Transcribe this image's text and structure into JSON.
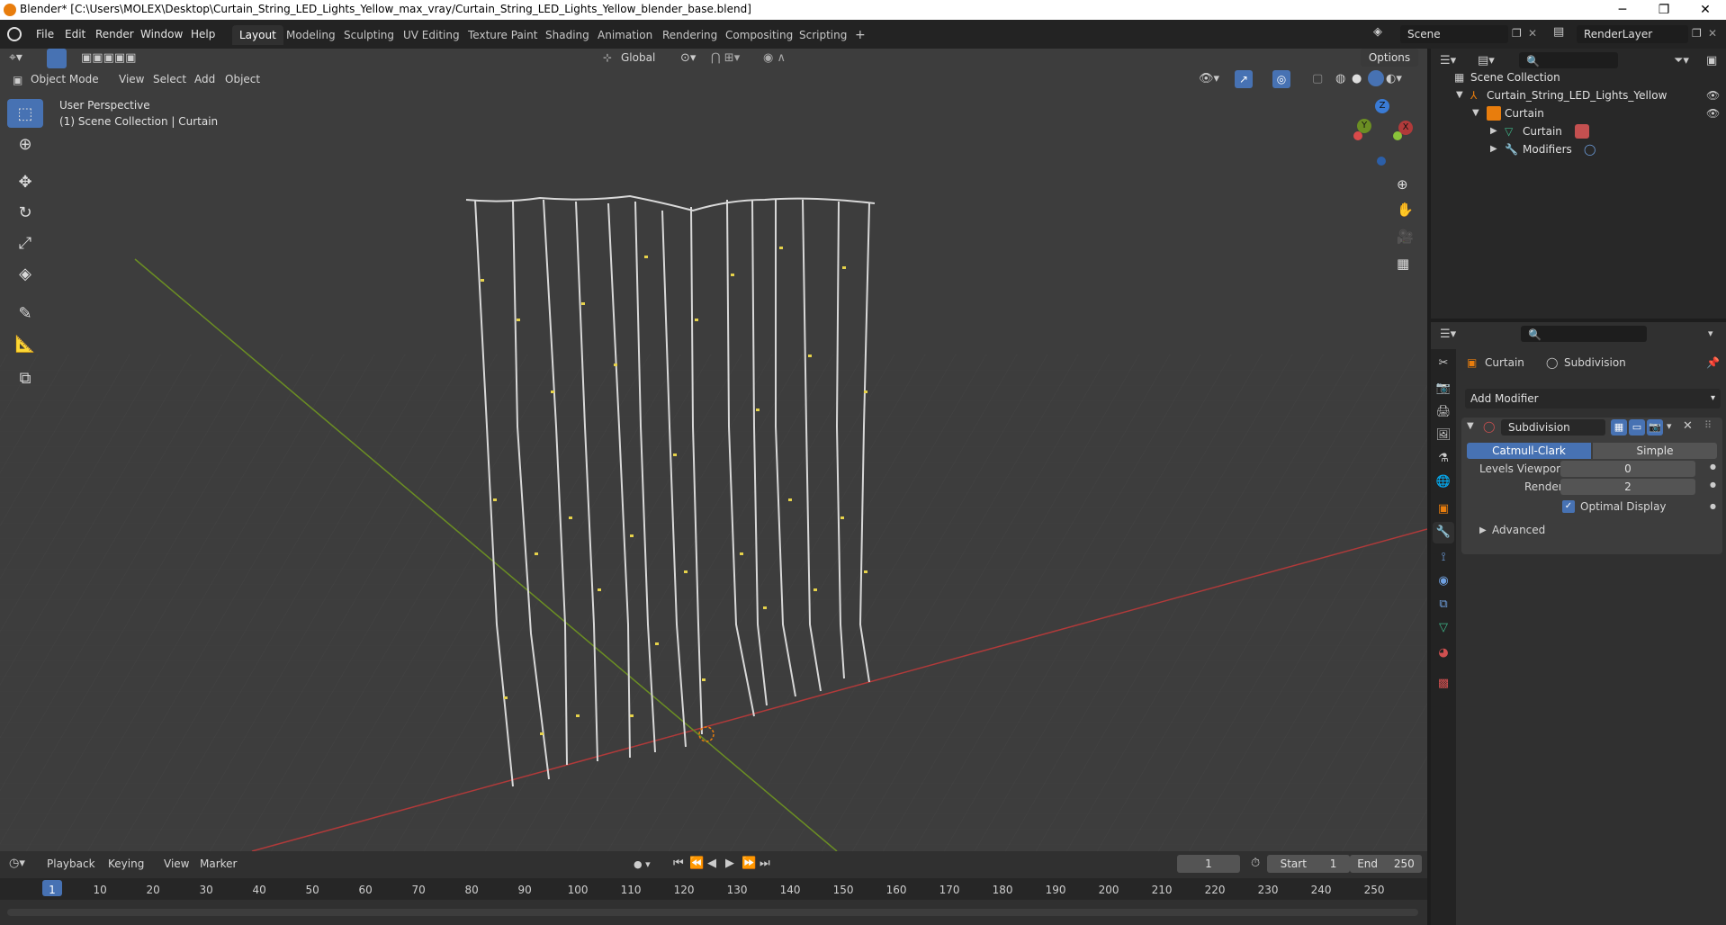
{
  "window": {
    "title": "Blender* [C:\\Users\\MOLEX\\Desktop\\Curtain_String_LED_Lights_Yellow_max_vray/Curtain_String_LED_Lights_Yellow_blender_base.blend]",
    "minimize": "─",
    "maximize": "❐",
    "close": "✕"
  },
  "menu": [
    "File",
    "Edit",
    "Render",
    "Window",
    "Help"
  ],
  "workspaces": [
    "Layout",
    "Modeling",
    "Sculpting",
    "UV Editing",
    "Texture Paint",
    "Shading",
    "Animation",
    "Rendering",
    "Compositing",
    "Scripting"
  ],
  "workspace_active": "Layout",
  "add_tab": "+",
  "scene": {
    "label": "Scene",
    "render_layer": "RenderLayer"
  },
  "viewport_header": {
    "transform_orientation": "Global",
    "options": "Options",
    "mode": "Object Mode",
    "menus": [
      "View",
      "Select",
      "Add",
      "Object"
    ]
  },
  "viewport": {
    "perspective": "User Perspective",
    "collection_info": "(1) Scene Collection | Curtain",
    "gizmo": {
      "z": "Z",
      "y": "Y",
      "x": "X"
    }
  },
  "outliner": {
    "search_placeholder": "",
    "rows": [
      {
        "label": "Scene Collection",
        "indent": 0
      },
      {
        "label": "Curtain_String_LED_Lights_Yellow",
        "indent": 1
      },
      {
        "label": "Curtain",
        "indent": 2
      },
      {
        "label": "Curtain",
        "indent": 3
      },
      {
        "label": "Modifiers",
        "indent": 3
      }
    ]
  },
  "properties": {
    "breadcrumb_object": "Curtain",
    "breadcrumb_modifier": "Subdivision",
    "add_modifier": "Add Modifier",
    "modifier_name": "Subdivision",
    "type_catmull": "Catmull-Clark",
    "type_simple": "Simple",
    "levels_viewport_label": "Levels Viewport",
    "levels_viewport_value": "0",
    "render_label": "Render",
    "render_value": "2",
    "optimal_display": "Optimal Display",
    "optimal_display_checked": true,
    "advanced": "Advanced"
  },
  "timeline": {
    "menus": [
      "Playback",
      "Keying",
      "View",
      "Marker"
    ],
    "current_frame": "1",
    "start_label": "Start",
    "start_value": "1",
    "end_label": "End",
    "end_value": "250",
    "ticks": [
      "1",
      "10",
      "20",
      "30",
      "40",
      "50",
      "60",
      "70",
      "80",
      "90",
      "100",
      "110",
      "120",
      "130",
      "140",
      "150",
      "160",
      "170",
      "180",
      "190",
      "200",
      "210",
      "220",
      "230",
      "240",
      "250"
    ]
  },
  "colors": {
    "accent": "#4772b3",
    "x_axis": "#b03a3a",
    "y_axis": "#6b8e23",
    "z_axis": "#3a7bd5"
  }
}
